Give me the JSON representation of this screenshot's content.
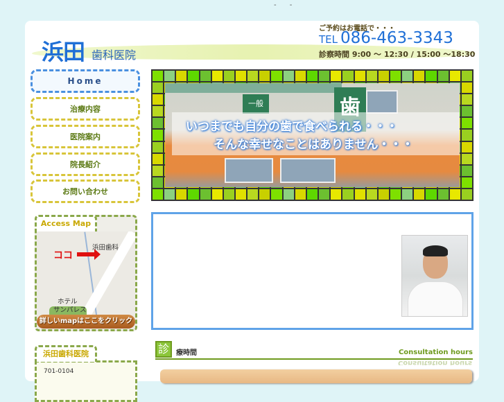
{
  "top_marker": "- -",
  "header": {
    "logo_main": "浜田",
    "logo_sub": "歯科医院",
    "reserve_note": "ご予約はお電話で・・・",
    "tel_label": "TEL",
    "tel_number": "086-463-3343",
    "hours": "診察時間 9:00 ～ 12:30 / 15:00 ～18:30"
  },
  "nav": [
    {
      "label": "Home"
    },
    {
      "label": "治療内容"
    },
    {
      "label": "医院案内"
    },
    {
      "label": "院長紹介"
    },
    {
      "label": "お問い合わせ"
    }
  ],
  "hero": {
    "sign_main": "歯",
    "sign_sub": "一般",
    "line1": "いつまでも自分の歯で食べられる・・・",
    "line2": "そんな幸せなことはありません・・・"
  },
  "access": {
    "tab": "Access Map",
    "here": "ココ",
    "clinic_label": "浜田歯科",
    "hotel_label_1": "ホテル",
    "hotel_label_2": "サンパレス",
    "button": "詳しいmapはここをクリック"
  },
  "info": {
    "tab": "浜田歯科医院",
    "postal": "701-0104"
  },
  "section": {
    "icon_char": "診",
    "title": "療時間",
    "title_en": "Consultation hours"
  }
}
